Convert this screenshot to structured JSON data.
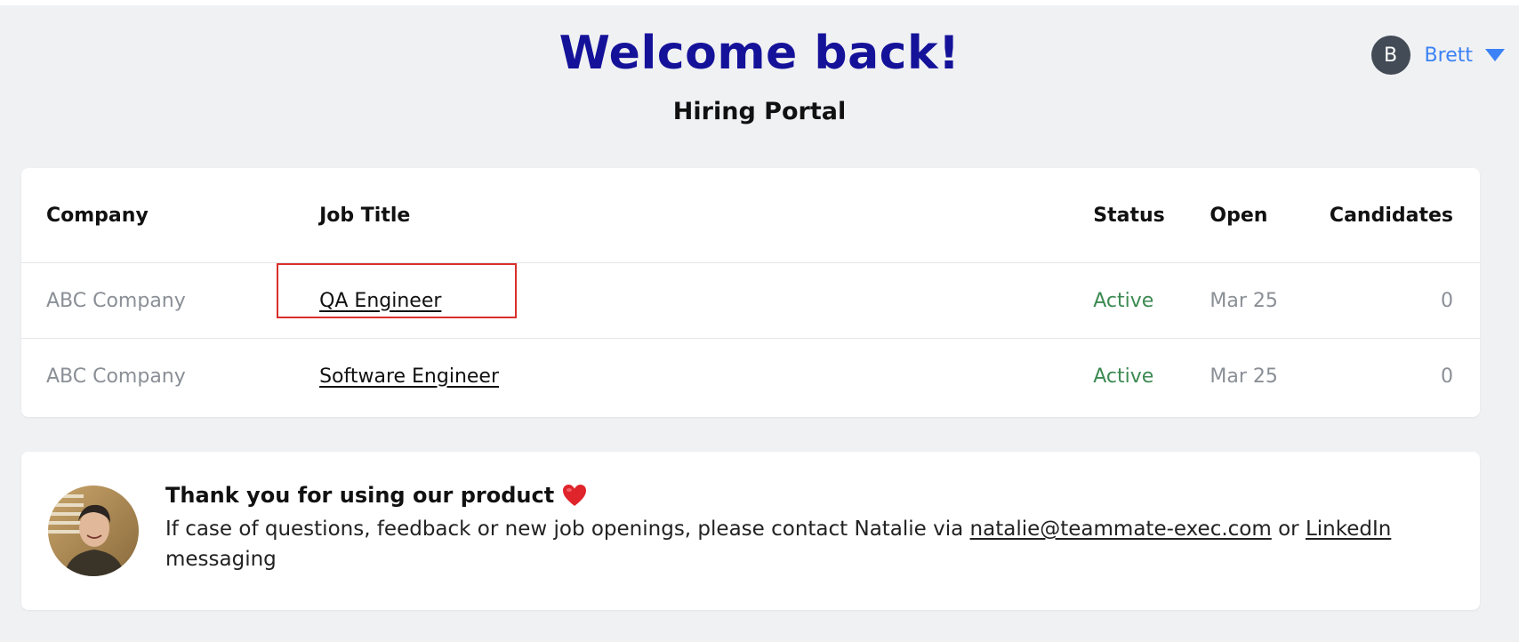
{
  "header": {
    "welcome": "Welcome back!",
    "subtitle": "Hiring Portal"
  },
  "user": {
    "initial": "B",
    "name": "Brett"
  },
  "table": {
    "columns": [
      "Company",
      "Job Title",
      "Status",
      "Open",
      "Candidates"
    ],
    "rows": [
      {
        "company": "ABC Company",
        "title": "QA Engineer",
        "status": "Active",
        "open": "Mar 25",
        "candidates": "0"
      },
      {
        "company": "ABC Company",
        "title": "Software Engineer",
        "status": "Active",
        "open": "Mar 25",
        "candidates": "0"
      }
    ]
  },
  "thanks": {
    "title": "Thank you for using our product",
    "heart_icon": "heart-icon",
    "body_prefix": "If case of questions, feedback or new job openings, please contact Natalie via ",
    "email": "natalie@teammate-exec.com",
    "middle": " or ",
    "linkedin": "LinkedIn",
    "suffix": " messaging"
  },
  "colors": {
    "welcome": "#15129a",
    "link_blue": "#3b82f6",
    "status_green": "#3c8a52",
    "highlight_red": "#d9302a"
  }
}
